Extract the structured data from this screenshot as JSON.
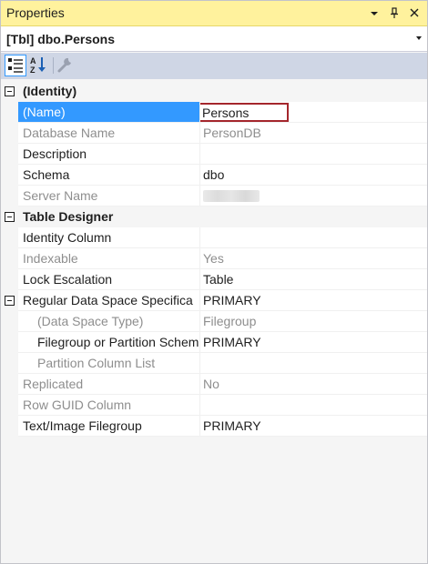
{
  "window": {
    "title": "Properties",
    "buttons": [
      "▾",
      "📌",
      "✕"
    ]
  },
  "object_selector": {
    "label": "[Tbl] dbo.Persons"
  },
  "toolbar": {
    "buttons": [
      "categorized-icon",
      "alphabetical-icon",
      "property-pages-icon"
    ]
  },
  "grid": {
    "rows": [
      {
        "type": "category",
        "name": "(Identity)",
        "value": ""
      },
      {
        "type": "property",
        "name": "(Name)",
        "value": "Persons",
        "selected": true,
        "readonly": false
      },
      {
        "type": "property",
        "name": "Database Name",
        "value": "PersonDB",
        "readonly": true
      },
      {
        "type": "property",
        "name": "Description",
        "value": "",
        "readonly": false
      },
      {
        "type": "property",
        "name": "Schema",
        "value": "dbo",
        "readonly": false
      },
      {
        "type": "property",
        "name": "Server Name",
        "value": "",
        "readonly": true,
        "blurred": true
      },
      {
        "type": "category",
        "name": "Table Designer",
        "value": ""
      },
      {
        "type": "property",
        "name": "Identity Column",
        "value": "",
        "readonly": false
      },
      {
        "type": "property",
        "name": "Indexable",
        "value": "Yes",
        "readonly": true
      },
      {
        "type": "property",
        "name": "Lock Escalation",
        "value": "Table",
        "readonly": false
      },
      {
        "type": "expandable",
        "name": "Regular Data Space Specifica",
        "value": "PRIMARY",
        "readonly": false
      },
      {
        "type": "sub",
        "name": "(Data Space Type)",
        "value": "Filegroup",
        "readonly": true
      },
      {
        "type": "sub",
        "name": "Filegroup or Partition Schem",
        "value": "PRIMARY",
        "readonly": false
      },
      {
        "type": "sub",
        "name": "Partition Column List",
        "value": "",
        "readonly": true
      },
      {
        "type": "property",
        "name": "Replicated",
        "value": "No",
        "readonly": true
      },
      {
        "type": "property",
        "name": "Row GUID Column",
        "value": "",
        "readonly": true
      },
      {
        "type": "property",
        "name": "Text/Image Filegroup",
        "value": "PRIMARY",
        "readonly": false
      }
    ]
  },
  "colors": {
    "title_bar": "#fff29d",
    "toolbar": "#cfd6e5",
    "selection": "#3399ff",
    "edit_border": "#a4262c",
    "readonly_text": "#8e8e8e"
  }
}
